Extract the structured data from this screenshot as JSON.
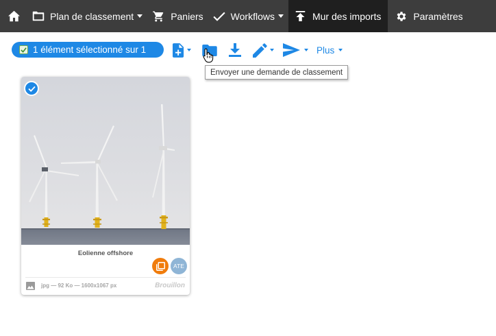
{
  "nav": {
    "home_icon": "home-icon",
    "items": [
      {
        "label": "Plan de classement",
        "icon": "folder-icon",
        "dropdown": true
      },
      {
        "label": "Paniers",
        "icon": "cart-icon",
        "dropdown": false
      },
      {
        "label": "Workflows",
        "icon": "check-icon",
        "dropdown": true
      },
      {
        "label": "Mur des imports",
        "icon": "upload-icon",
        "dropdown": false,
        "active": true
      },
      {
        "label": "Paramètres",
        "icon": "gear-icon",
        "dropdown": false
      }
    ],
    "background": "#3d3d3d",
    "active_background": "#1f1f1f"
  },
  "toolbar": {
    "selection_label": "1 élément sélectionné sur 1",
    "buttons": [
      {
        "icon": "add-document-icon",
        "dropdown": true
      },
      {
        "icon": "folder-icon",
        "dropdown": false
      },
      {
        "icon": "download-icon",
        "dropdown": false
      },
      {
        "icon": "pencil-icon",
        "dropdown": true
      },
      {
        "icon": "send-icon",
        "dropdown": true
      }
    ],
    "more_label": "Plus",
    "accent": "#1e88e5"
  },
  "tooltip": {
    "text": "Envoyer une demande de classement"
  },
  "card": {
    "title": "Eolienne offshore",
    "selected": true,
    "badge_ate": "ATE",
    "badge_orange_icon": "copy-icon",
    "file_meta": "jpg — 92 Ko — 1600x1067 px",
    "status": "Brouillon",
    "file_type_icon": "image-icon"
  }
}
